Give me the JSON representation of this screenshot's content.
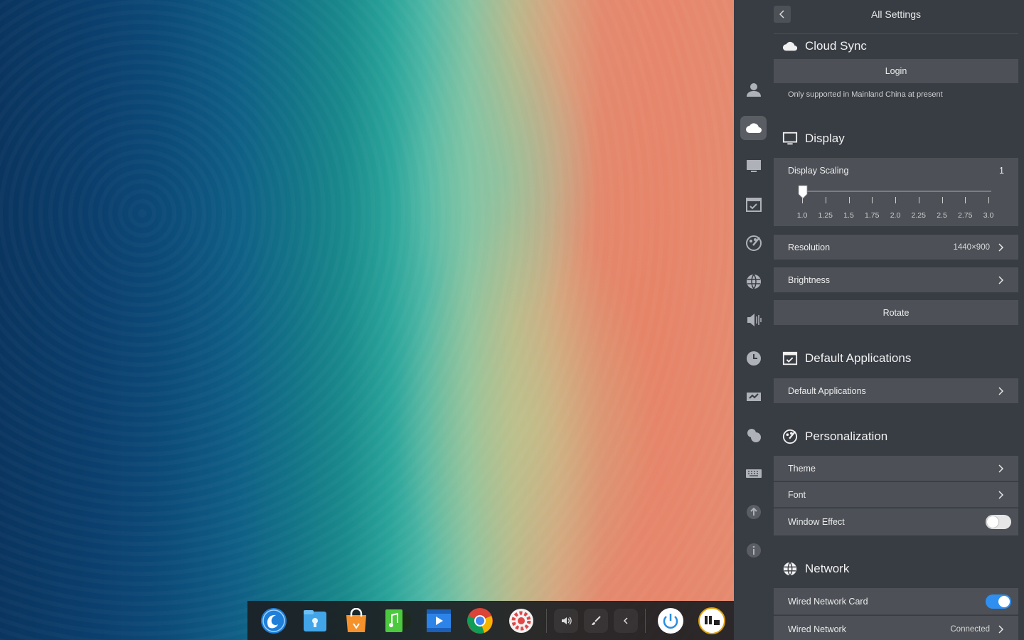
{
  "dock": {
    "apps": [
      {
        "name": "launcher-icon",
        "color": "#2b8de0"
      },
      {
        "name": "file-manager-icon",
        "color": "#3aa6e6"
      },
      {
        "name": "app-store-icon",
        "color": "#f08a22"
      },
      {
        "name": "music-icon",
        "color": "#3bbf3a"
      },
      {
        "name": "movie-icon",
        "color": "#2a7de0"
      },
      {
        "name": "chrome-icon",
        "color": "#e0e0e0"
      },
      {
        "name": "settings-icon",
        "color": "#e04848"
      }
    ],
    "tray": [
      "volume-icon",
      "brush-icon",
      "collapse-icon"
    ],
    "power": "power-icon",
    "clock": "clock-icon"
  },
  "header": {
    "title": "All Settings"
  },
  "cloud_sync": {
    "title": "Cloud Sync",
    "login_label": "Login",
    "note": "Only supported in Mainland China at present"
  },
  "display": {
    "title": "Display",
    "scaling_label": "Display Scaling",
    "scaling_value": "1",
    "scaling_ticks": [
      "1.0",
      "1.25",
      "1.5",
      "1.75",
      "2.0",
      "2.25",
      "2.5",
      "2.75",
      "3.0"
    ],
    "resolution_label": "Resolution",
    "resolution_value": "1440×900",
    "brightness_label": "Brightness",
    "rotate_label": "Rotate"
  },
  "default_apps": {
    "title": "Default Applications",
    "row_label": "Default Applications"
  },
  "personalization": {
    "title": "Personalization",
    "theme_label": "Theme",
    "font_label": "Font",
    "window_effect_label": "Window Effect",
    "window_effect_on": false
  },
  "network": {
    "title": "Network",
    "wired_card_label": "Wired Network Card",
    "wired_card_on": true,
    "wired_network_label": "Wired Network",
    "wired_network_status": "Connected"
  },
  "colors": {
    "panel_bg": "#383c43",
    "row_bg": "#4d5157",
    "accent": "#2f8ff0"
  }
}
